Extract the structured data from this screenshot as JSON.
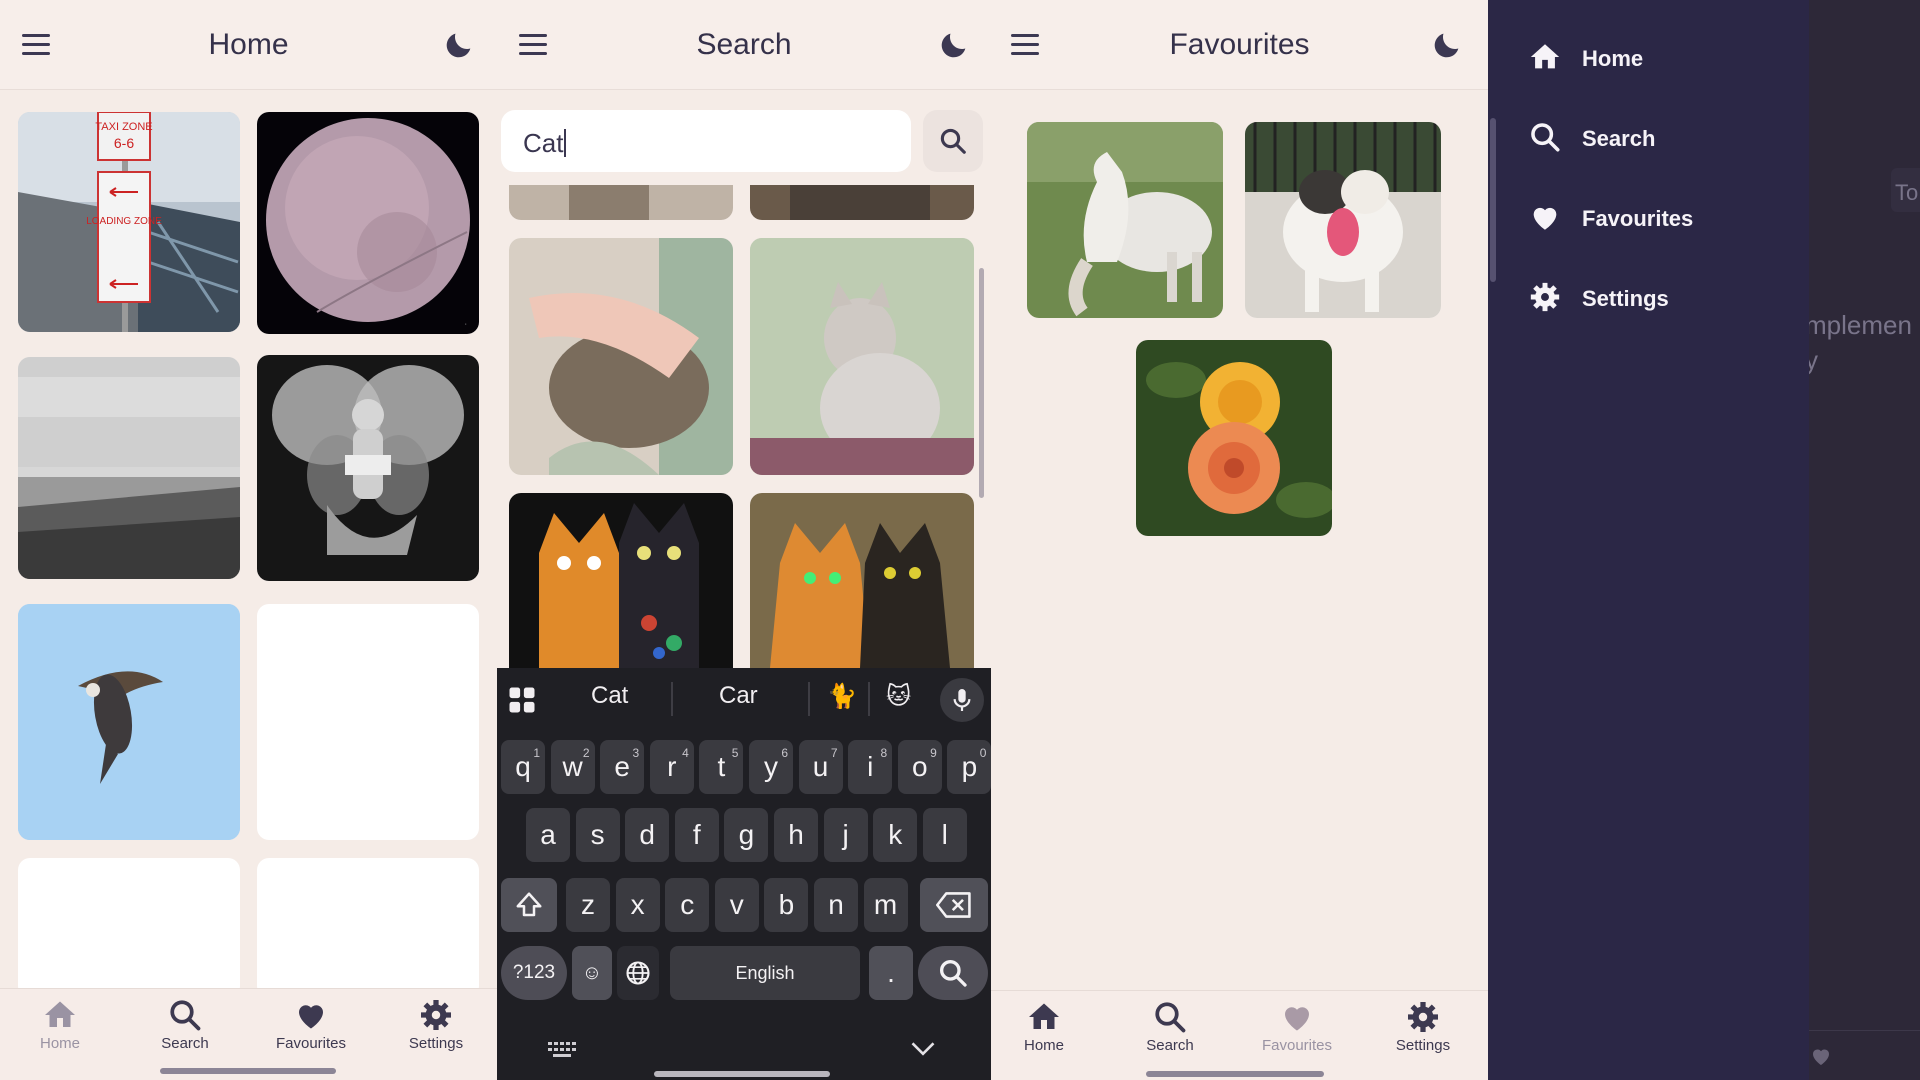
{
  "home_screen": {
    "title": "Home",
    "nav": [
      {
        "label": "Home",
        "icon": "home-icon"
      },
      {
        "label": "Search",
        "icon": "search-icon"
      },
      {
        "label": "Favourites",
        "icon": "heart-icon"
      },
      {
        "label": "Settings",
        "icon": "gear-icon"
      }
    ],
    "images": [
      {
        "name": "taxi-zone-sign",
        "sign_texts": [
          "TAXI ZONE",
          "6-6",
          "LOADING ZONE"
        ]
      },
      {
        "name": "fisheye-sky"
      },
      {
        "name": "ocean-beach"
      },
      {
        "name": "fairy-reading"
      },
      {
        "name": "eagle-flying"
      },
      {
        "name": "blank-tile"
      },
      {
        "name": "blank-tile"
      },
      {
        "name": "blank-tile"
      }
    ]
  },
  "search_screen": {
    "title": "Search",
    "query": "Cat",
    "results": [
      "cat-partial-1",
      "cat-partial-2",
      "hand-petting-cat",
      "cat-behind-curtain",
      "painted-cats-1",
      "painted-cats-2"
    ],
    "keyboard": {
      "suggestions": [
        "Cat",
        "Car"
      ],
      "emoji_suggestions": [
        "🐈",
        "🐱"
      ],
      "row1": [
        {
          "k": "q",
          "n": "1"
        },
        {
          "k": "w",
          "n": "2"
        },
        {
          "k": "e",
          "n": "3"
        },
        {
          "k": "r",
          "n": "4"
        },
        {
          "k": "t",
          "n": "5"
        },
        {
          "k": "y",
          "n": "6"
        },
        {
          "k": "u",
          "n": "7"
        },
        {
          "k": "i",
          "n": "8"
        },
        {
          "k": "o",
          "n": "9"
        },
        {
          "k": "p",
          "n": "0"
        }
      ],
      "row2": [
        "a",
        "s",
        "d",
        "f",
        "g",
        "h",
        "j",
        "k",
        "l"
      ],
      "row3": [
        "z",
        "x",
        "c",
        "v",
        "b",
        "n",
        "m"
      ],
      "symbols_label": "?123",
      "space_label": "English",
      "period_label": "."
    }
  },
  "favourites_screen": {
    "title": "Favourites",
    "images": [
      "white-horses",
      "happy-dog",
      "orange-roses"
    ]
  },
  "drawer": {
    "items": [
      {
        "label": "Home",
        "icon": "home-icon"
      },
      {
        "label": "Search",
        "icon": "search-icon"
      },
      {
        "label": "Favourites",
        "icon": "heart-icon"
      },
      {
        "label": "Settings",
        "icon": "gear-icon"
      }
    ]
  },
  "background_screen": {
    "fragments": [
      "To",
      "mplemen",
      "y"
    ]
  },
  "colors": {
    "surface": "#f5ece7",
    "drawer": "#2b2746",
    "text": "#35314a",
    "keyboard": "#1f1f24"
  }
}
